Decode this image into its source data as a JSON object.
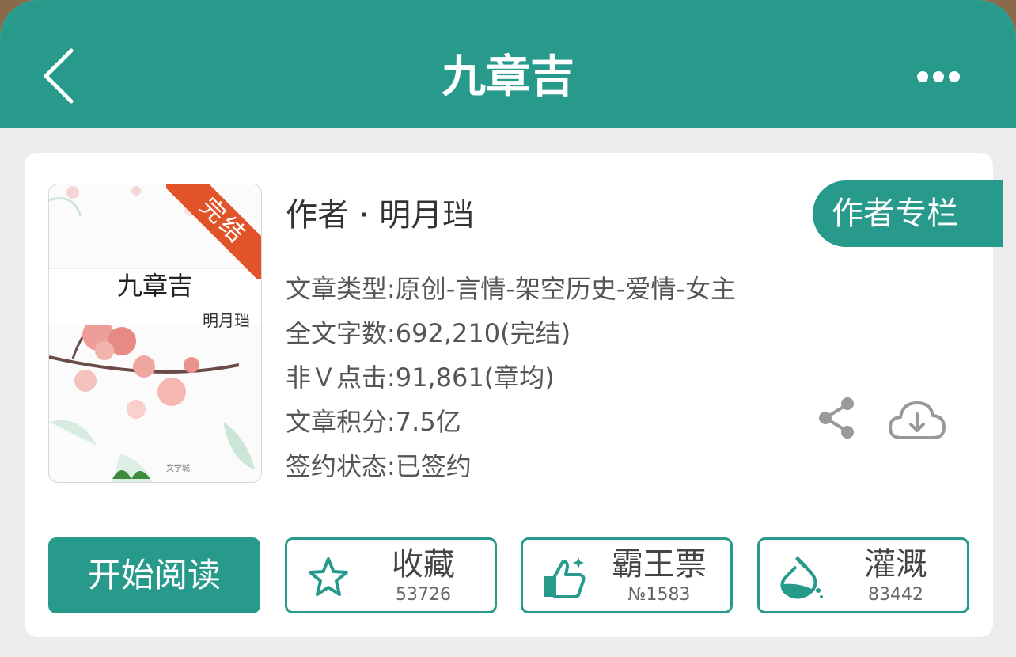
{
  "nav": {
    "title": "九章吉"
  },
  "book": {
    "cover_title": "九章吉",
    "cover_author": "明月珰",
    "status_ribbon": "完结",
    "cover_logo": "文学城",
    "author_line": "作者 · 明月珰",
    "author_column_button": "作者专栏",
    "info": [
      "文章类型:原创-言情-架空历史-爱情-女主",
      "全文字数:692,210(完结)",
      "非Ｖ点击:91,861(章均)",
      "文章积分:7.5亿",
      "签约状态:已签约"
    ]
  },
  "actions": {
    "read": "开始阅读",
    "collect": {
      "label": "收藏",
      "count": "53726"
    },
    "vote": {
      "label": "霸王票",
      "count": "№1583"
    },
    "nutrient": {
      "label": "灌溉",
      "count": "83442"
    }
  },
  "colors": {
    "accent": "#289a8c",
    "ribbon": "#e1542a"
  }
}
